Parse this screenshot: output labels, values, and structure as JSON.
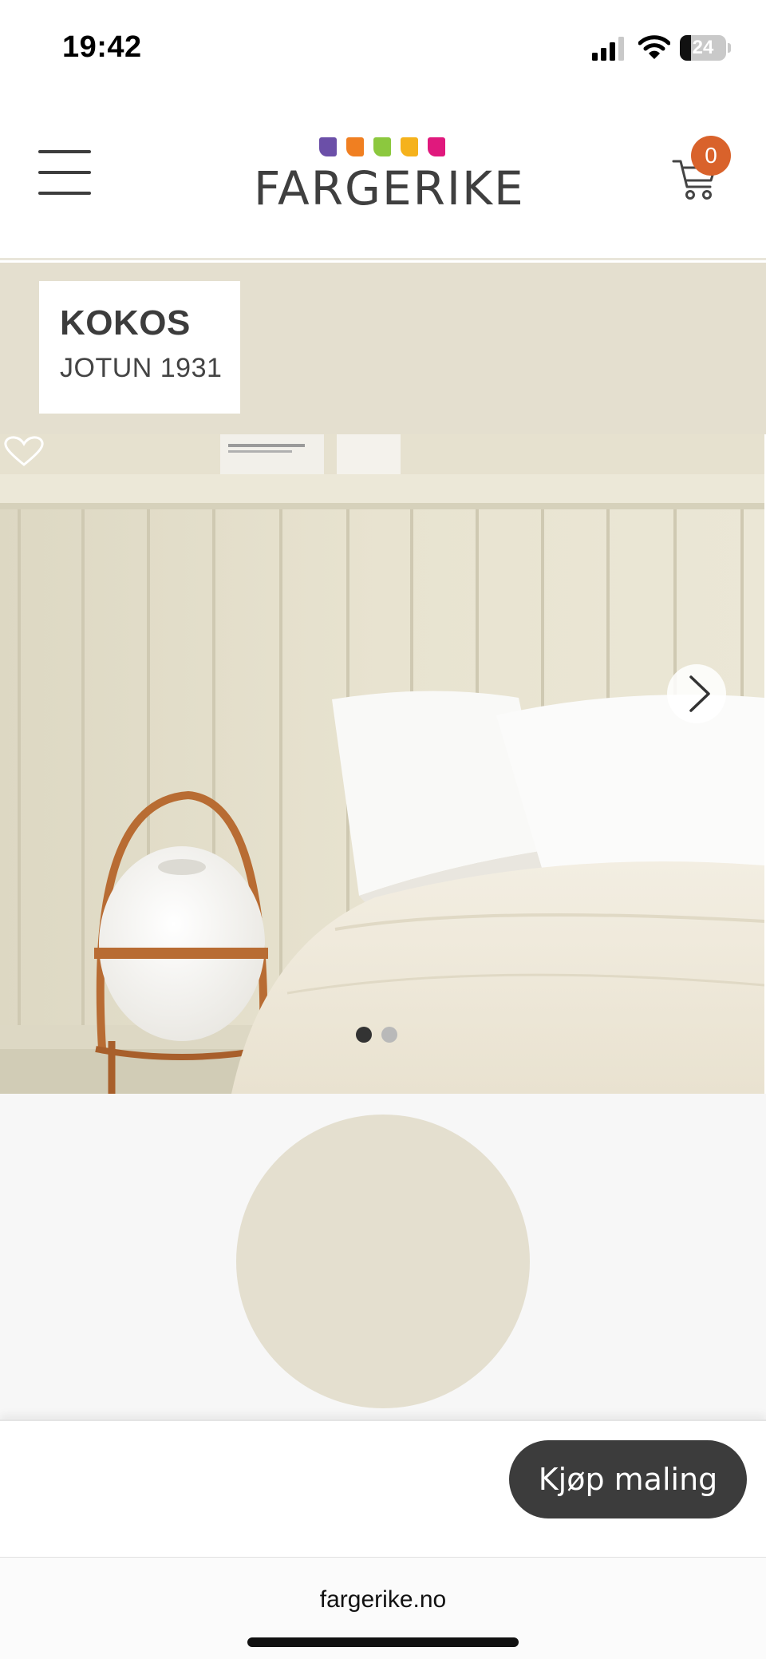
{
  "status_bar": {
    "time": "19:42",
    "battery_level": "24",
    "icons": [
      "signal-icon",
      "wifi-icon",
      "battery-icon"
    ]
  },
  "header": {
    "logo_text": "FARGERIKE",
    "logo_flag_colors": [
      "#6b4fa8",
      "#f07f21",
      "#8cc83e",
      "#f5b21c",
      "#e0197d"
    ],
    "cart_count": "0",
    "accent_color": "#d9622b",
    "icons": [
      "menu-icon",
      "cart-icon"
    ]
  },
  "color": {
    "name": "KOKOS",
    "code": "JOTUN 1931",
    "swatch_hex": "#e4dfcf"
  },
  "carousel": {
    "slide_count": 2,
    "active_slide": 1,
    "icons": [
      "chevron-right-icon",
      "heart-icon"
    ]
  },
  "actions": {
    "buy_label": "Kjøp maling"
  },
  "browser": {
    "url": "fargerike.no"
  }
}
